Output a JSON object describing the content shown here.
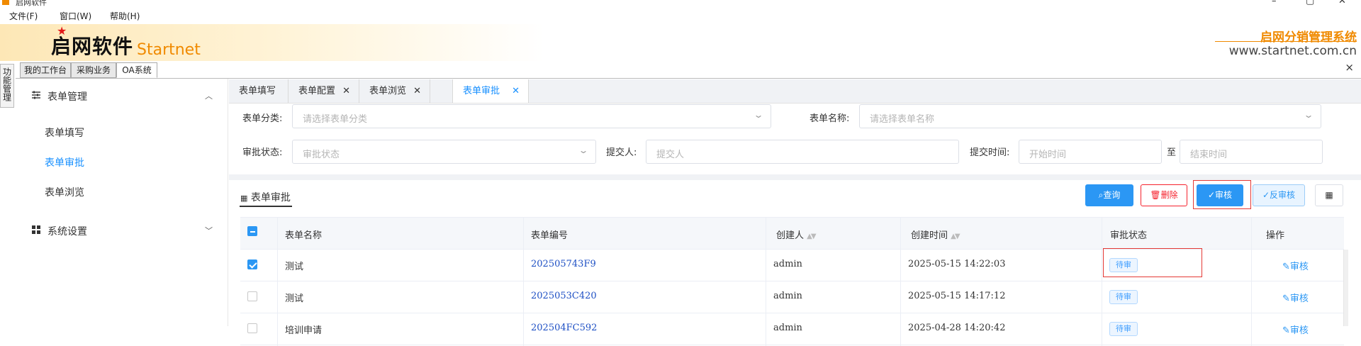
{
  "window": {
    "title": "启网软件",
    "min": "–",
    "max": "▢",
    "close": "✕"
  },
  "menu": [
    "文件(F)",
    "窗口(W)",
    "帮助(H)"
  ],
  "banner": {
    "logo_cn": "启网软件",
    "logo_en": "Startnet",
    "system_name": "启网分销管理系统",
    "url": "www.startnet.com.cn"
  },
  "vertical_tab": "功能管理",
  "workspace_tabs": [
    "我的工作台",
    "采购业务",
    "OA系统"
  ],
  "close_glyph": "×",
  "sidebar": {
    "group1": "表单管理",
    "items": [
      "表单填写",
      "表单审批",
      "表单浏览"
    ],
    "group2": "系统设置"
  },
  "page_tabs": [
    {
      "label": "表单填写",
      "closable": false
    },
    {
      "label": "表单配置",
      "closable": true
    },
    {
      "label": "表单浏览",
      "closable": true
    },
    {
      "label": "表单审批",
      "closable": true
    }
  ],
  "filters": {
    "category_label": "表单分类:",
    "category_placeholder": "请选择表单分类",
    "name_label": "表单名称:",
    "name_placeholder": "请选择表单名称",
    "status_label": "审批状态:",
    "status_placeholder": "审批状态",
    "submitter_label": "提交人:",
    "submitter_placeholder": "提交人",
    "time_label": "提交时间:",
    "start_placeholder": "开始时间",
    "to": "至",
    "end_placeholder": "结束时间"
  },
  "toolbar": {
    "section_title": "表单审批",
    "query": "查询",
    "delete": "删除",
    "audit": "审核",
    "unaudit": "反审核"
  },
  "table": {
    "columns": [
      "表单名称",
      "表单编号",
      "创建人",
      "创建时间",
      "审批状态",
      "操作"
    ],
    "rows": [
      {
        "name": "测试",
        "code": "202505743F9",
        "creator": "admin",
        "created": "2025-05-15 14:22:03",
        "status": "待审",
        "action": "审核",
        "checked": true
      },
      {
        "name": "测试",
        "code": "2025053C420",
        "creator": "admin",
        "created": "2025-05-15 14:17:12",
        "status": "待审",
        "action": "审核",
        "checked": false
      },
      {
        "name": "培训申请",
        "code": "202504FC592",
        "creator": "admin",
        "created": "2025-04-28 14:20:42",
        "status": "待审",
        "action": "审核",
        "checked": false
      }
    ]
  },
  "colors": {
    "accent": "#2b97f4",
    "danger": "#f5222d",
    "brand_orange": "#f08a00",
    "highlight": "#e53935"
  }
}
